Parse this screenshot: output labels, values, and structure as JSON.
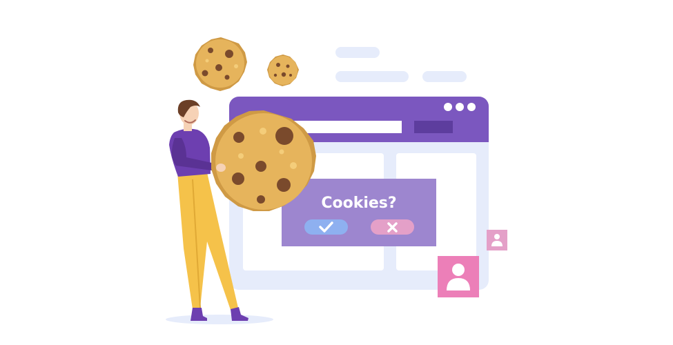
{
  "popup": {
    "title": "Cookies?",
    "accept_icon": "checkmark-icon",
    "decline_icon": "cross-icon"
  },
  "browser": {
    "window_dots": [
      "dot",
      "dot",
      "dot"
    ]
  },
  "icons": {
    "small_badge": "user-icon",
    "large_badge": "user-icon"
  },
  "colors": {
    "browser_header": "#7b57bf",
    "browser_body": "#e6ecfb",
    "popup_bg": "#9d86cf",
    "accept": "#8eb0f0",
    "decline": "#e4a0c8",
    "badge": "#ec7fb8",
    "cookie": "#e6b45c",
    "chip": "#7a4a2c",
    "shirt": "#6d3fb0",
    "pants": "#f5c24a"
  }
}
